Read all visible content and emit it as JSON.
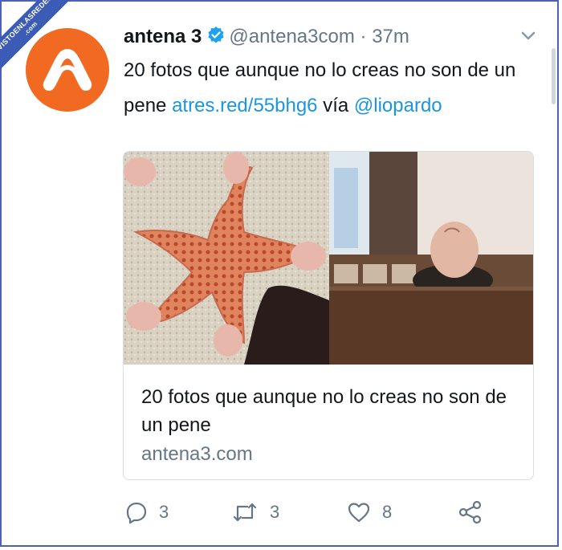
{
  "watermark": {
    "line1": "VISTOENLASREDES",
    "line2": ".com"
  },
  "tweet": {
    "author_name": "antena 3",
    "handle": "@antena3com",
    "separator": "·",
    "time": "37m",
    "text_main": "20 fotos que aunque no lo creas no son de un pene",
    "link": "atres.red/55bhg6",
    "via": "vía",
    "mention": "@liopardo"
  },
  "card": {
    "title": "20 fotos que aunque no lo creas no son de un pene",
    "domain": "antena3.com"
  },
  "actions": {
    "reply_count": "3",
    "retweet_count": "3",
    "like_count": "8"
  },
  "colors": {
    "avatar_bg": "#f26a21",
    "link": "#1b95e0",
    "verified": "#1da1f2",
    "muted": "#657786"
  },
  "icons": {
    "verified": "verified-badge-icon",
    "chevron": "chevron-down-icon",
    "reply": "reply-icon",
    "retweet": "retweet-icon",
    "like": "heart-icon",
    "share": "share-icon"
  }
}
